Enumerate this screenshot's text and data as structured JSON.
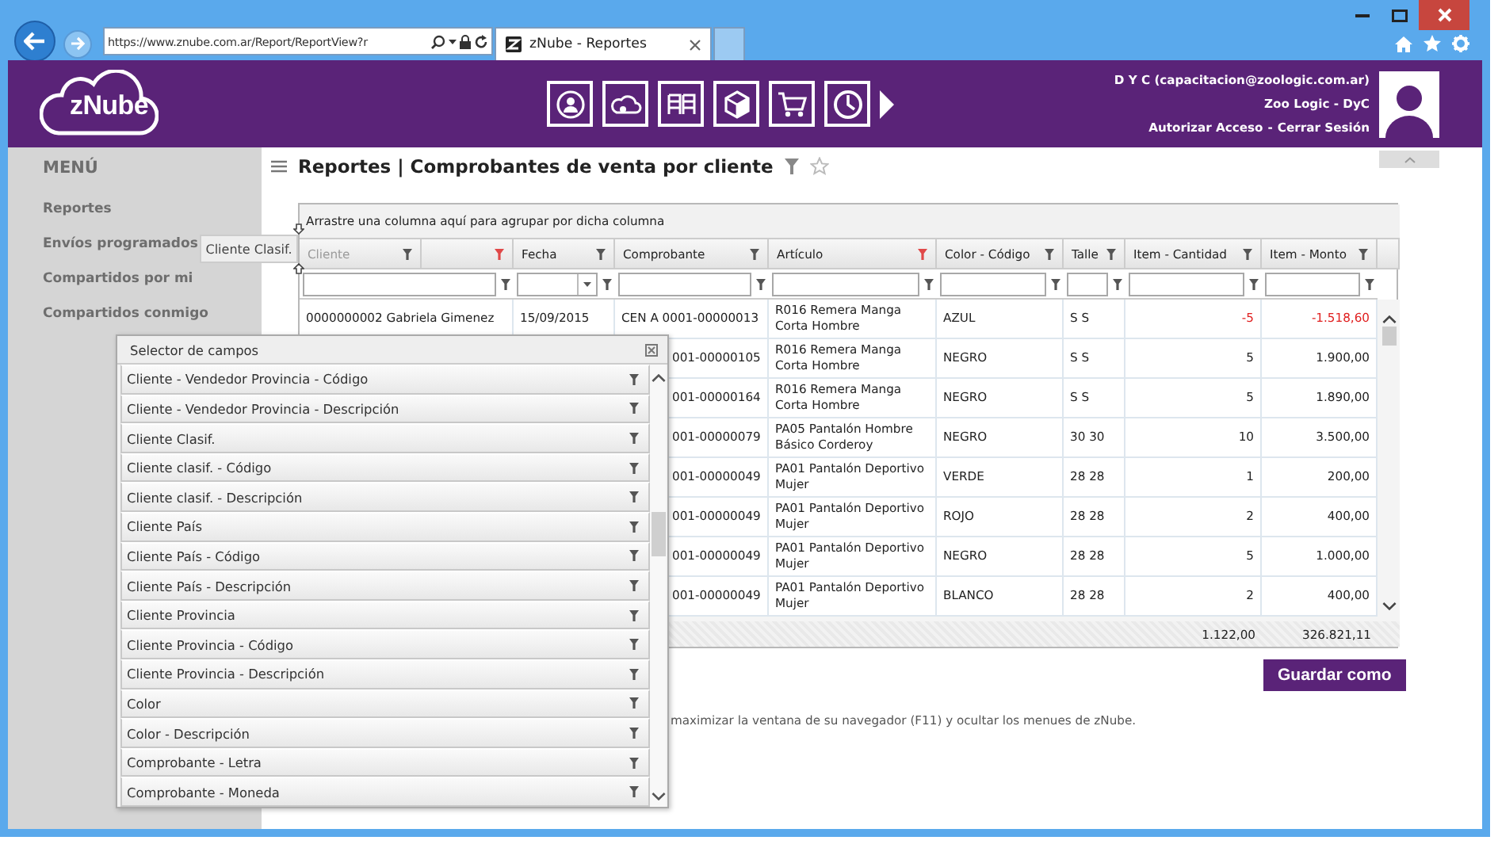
{
  "browser": {
    "url": "https://www.znube.com.ar/Report/ReportView?r",
    "tabs": [
      {
        "title": "zNube - Reportes",
        "selected": true
      }
    ]
  },
  "header": {
    "logo": "zNube",
    "user": "D Y C (capacitacion@zoologic.com.ar)",
    "company": "Zoo Logic - DyC",
    "links": [
      "Autorizar Acceso",
      "Cerrar Sesión"
    ],
    "link_separator": "-"
  },
  "menu": {
    "title": "MENÚ",
    "items": [
      "Reportes",
      "Envíos programados",
      "Compartidos por mi",
      "Compartidos conmigo"
    ]
  },
  "page": {
    "title": "Reportes | Comprobantes de venta por cliente"
  },
  "table": {
    "group_hint": "Arrastre una columna aquí para agrupar por dicha columna",
    "columns": [
      {
        "label": "Cliente",
        "dimmed": true,
        "filtered": false,
        "kind": "text"
      },
      {
        "dimmed": false,
        "filtered": true,
        "kind": "none"
      },
      {
        "label": "Fecha",
        "dimmed": false,
        "filtered": false,
        "kind": "combo"
      },
      {
        "label": "Comprobante",
        "dimmed": false,
        "filtered": false,
        "kind": "text"
      },
      {
        "label": "Artículo",
        "dimmed": false,
        "filtered": true,
        "kind": "text"
      },
      {
        "label": "Color - Código",
        "dimmed": false,
        "filtered": false,
        "kind": "text"
      },
      {
        "label": "Talle",
        "dimmed": false,
        "filtered": false,
        "kind": "text"
      },
      {
        "label": "Item - Cantidad",
        "dimmed": false,
        "filtered": false,
        "kind": "text"
      },
      {
        "label": "Item - Monto",
        "dimmed": false,
        "filtered": false,
        "kind": "text"
      }
    ],
    "rows": [
      {
        "cliente": "0000000002 Gabriela Gimenez",
        "fecha": "15/09/2015",
        "comprobante": "CEN A 0001-00000013",
        "articulo": "R016 Remera Manga Corta Hombre",
        "color_code": "AZUL",
        "talle": "S S",
        "cantidad": "-5",
        "monto": "-1.518,60",
        "negative": true
      },
      {
        "comprobante": "001-00000105",
        "articulo": "R016 Remera Manga Corta Hombre",
        "color_code": "NEGRO",
        "talle": "S S",
        "cantidad": "5",
        "monto": "1.900,00",
        "negative": false
      },
      {
        "comprobante": "001-00000164",
        "articulo": "R016 Remera Manga Corta Hombre",
        "color_code": "NEGRO",
        "talle": "S S",
        "cantidad": "5",
        "monto": "1.890,00",
        "negative": false
      },
      {
        "comprobante": "001-00000079",
        "articulo": "PA05 Pantalón Hombre Básico Corderoy",
        "color_code": "NEGRO",
        "talle": "30 30",
        "cantidad": "10",
        "monto": "3.500,00",
        "negative": false
      },
      {
        "comprobante": "001-00000049",
        "articulo": "PA01 Pantalón Deportivo Mujer",
        "color_code": "VERDE",
        "talle": "28 28",
        "cantidad": "1",
        "monto": "200,00",
        "negative": false
      },
      {
        "comprobante": "001-00000049",
        "articulo": "PA01 Pantalón Deportivo Mujer",
        "color_code": "ROJO",
        "talle": "28 28",
        "cantidad": "2",
        "monto": "400,00",
        "negative": false
      },
      {
        "comprobante": "001-00000049",
        "articulo": "PA01 Pantalón Deportivo Mujer",
        "color_code": "NEGRO",
        "talle": "28 28",
        "cantidad": "5",
        "monto": "1.000,00",
        "negative": false
      },
      {
        "comprobante": "001-00000049",
        "articulo": "PA01 Pantalón Deportivo Mujer",
        "color_code": "BLANCO",
        "talle": "28 28",
        "cantidad": "2",
        "monto": "400,00",
        "negative": false
      }
    ],
    "totals": {
      "cantidad": "1.122,00",
      "monto": "326.821,11"
    }
  },
  "save_button": "Guardar como",
  "note": "maximizar la ventana de su navegador (F11) y ocultar los menues de zNube.",
  "drag_ghost": "Cliente Clasif.",
  "selector": {
    "title": "Selector de campos",
    "fields": [
      "Cliente - Vendedor Provincia - Código",
      "Cliente - Vendedor Provincia - Descripción",
      "Cliente Clasif.",
      "Cliente clasif. - Código",
      "Cliente clasif. - Descripción",
      "Cliente País",
      "Cliente País - Código",
      "Cliente País - Descripción",
      "Cliente Provincia",
      "Cliente Provincia - Código",
      "Cliente Provincia - Descripción",
      "Color",
      "Color - Descripción",
      "Comprobante - Letra",
      "Comprobante - Moneda"
    ]
  }
}
